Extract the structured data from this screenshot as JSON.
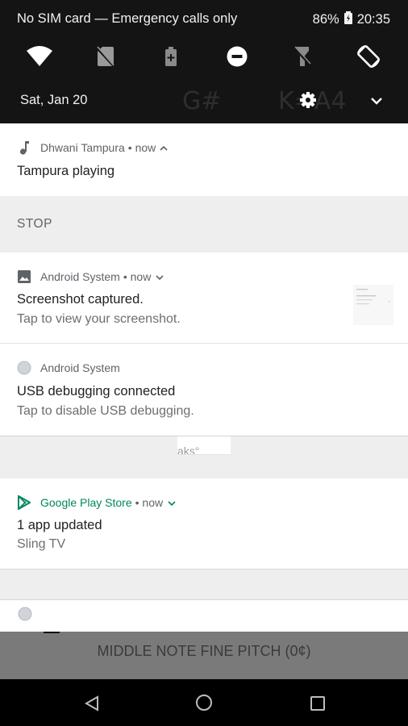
{
  "status_bar": {
    "carrier": "No SIM card — Emergency calls only",
    "battery": "86%",
    "time": "20:35"
  },
  "quick_settings": {
    "date": "Sat, Jan 20",
    "background_fragments": [
      "G#",
      "K=A4"
    ]
  },
  "notifications": {
    "tampura": {
      "app": "Dhwani Tampura",
      "meta": "• now",
      "title": "Tampura playing",
      "action": "STOP"
    },
    "screenshot": {
      "app": "Android System",
      "meta": "• now",
      "title": "Screenshot captured.",
      "text": "Tap to view your screenshot."
    },
    "usb": {
      "app": "Android System",
      "title": "USB debugging connected",
      "text": "Tap to disable USB debugging."
    },
    "play": {
      "app": "Google Play Store",
      "meta": "• now",
      "title": "1 app updated",
      "text": "Sling TV"
    }
  },
  "partial_text": "aks°",
  "background_app": {
    "label": "MIDDLE NOTE FINE PITCH (0¢)"
  },
  "colors": {
    "play_green": "#01875f",
    "panel_dark": "#141414",
    "divider_grey": "#eeeeee"
  }
}
